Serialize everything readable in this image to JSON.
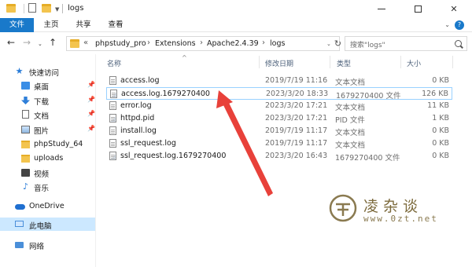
{
  "window": {
    "title": "logs",
    "minimize_icon": "minimize-icon",
    "maximize_icon": "maximize-icon",
    "close_label": "✕"
  },
  "ribbon": {
    "tabs": [
      "文件",
      "主页",
      "共享",
      "查看"
    ],
    "help_label": "?"
  },
  "address": {
    "prefix": "«",
    "crumbs": [
      "phpstudy_pro",
      "Extensions",
      "Apache2.4.39",
      "logs"
    ],
    "separator": "›"
  },
  "search": {
    "placeholder": "搜索\"logs\""
  },
  "sidebar": {
    "items": [
      {
        "label": "快速访问",
        "icon": "star-icon"
      },
      {
        "label": "桌面",
        "icon": "desktop-icon",
        "pinned": true
      },
      {
        "label": "下载",
        "icon": "download-icon",
        "pinned": true
      },
      {
        "label": "文档",
        "icon": "document-icon",
        "pinned": true
      },
      {
        "label": "图片",
        "icon": "picture-icon",
        "pinned": true
      },
      {
        "label": "phpStudy_64",
        "icon": "folder-icon"
      },
      {
        "label": "uploads",
        "icon": "folder-icon"
      },
      {
        "label": "视频",
        "icon": "video-icon"
      },
      {
        "label": "音乐",
        "icon": "music-icon"
      },
      {
        "label": "OneDrive",
        "icon": "cloud-icon"
      },
      {
        "label": "此电脑",
        "icon": "computer-icon",
        "selected": true
      },
      {
        "label": "网络",
        "icon": "network-icon"
      }
    ],
    "pin_glyph": "📌"
  },
  "columns": {
    "name": "名称",
    "date": "修改日期",
    "type": "类型",
    "size": "大小"
  },
  "files": [
    {
      "name": "access.log",
      "date": "2019/7/19 11:16",
      "type": "文本文档",
      "size": "0 KB",
      "icon": "text-file-icon"
    },
    {
      "name": "access.log.1679270400",
      "date": "2023/3/20 18:33",
      "type": "1679270400 文件",
      "size": "126 KB",
      "icon": "generic-file-icon",
      "selected": true
    },
    {
      "name": "error.log",
      "date": "2023/3/20 17:21",
      "type": "文本文档",
      "size": "11 KB",
      "icon": "text-file-icon"
    },
    {
      "name": "httpd.pid",
      "date": "2023/3/20 17:21",
      "type": "PID 文件",
      "size": "1 KB",
      "icon": "generic-file-icon"
    },
    {
      "name": "install.log",
      "date": "2019/7/19 11:17",
      "type": "文本文档",
      "size": "0 KB",
      "icon": "text-file-icon"
    },
    {
      "name": "ssl_request.log",
      "date": "2019/7/19 11:17",
      "type": "文本文档",
      "size": "0 KB",
      "icon": "text-file-icon"
    },
    {
      "name": "ssl_request.log.1679270400",
      "date": "2023/3/20 16:43",
      "type": "1679270400 文件",
      "size": "0 KB",
      "icon": "generic-file-icon"
    }
  ],
  "watermark": {
    "title": "凌杂谈",
    "url": "www.0zt.net"
  },
  "colors": {
    "accent": "#1979ca",
    "selection": "#cce8ff",
    "annotation_arrow": "#e8413a"
  }
}
